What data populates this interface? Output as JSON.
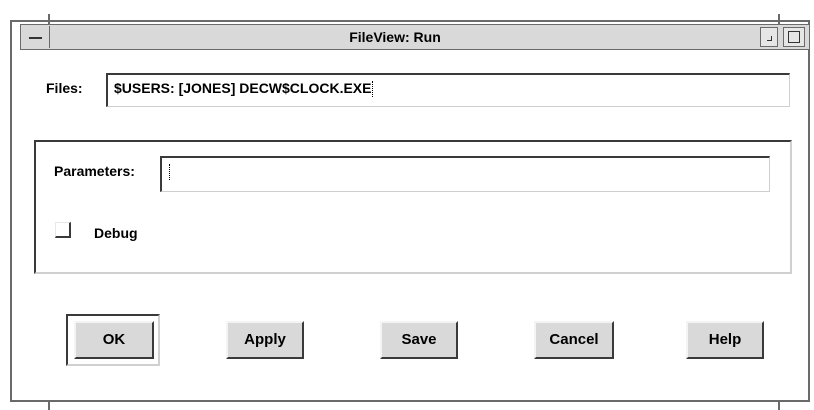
{
  "window": {
    "title": "FileView: Run",
    "menu_icon": "window-menu-icon",
    "minimize_icon": "minimize-icon",
    "maximize_icon": "maximize-icon"
  },
  "files": {
    "label": "Files:",
    "value": "$USERS: [JONES] DECW$CLOCK.EXE"
  },
  "parameters": {
    "label": "Parameters:",
    "value": ""
  },
  "debug": {
    "label": "Debug",
    "checked": false
  },
  "buttons": {
    "ok": "OK",
    "apply": "Apply",
    "save": "Save",
    "cancel": "Cancel",
    "help": "Help"
  },
  "colors": {
    "titlebar": "#d9d9d9",
    "button_face": "#d9d9d9",
    "shadow": "#3a3a3a"
  }
}
